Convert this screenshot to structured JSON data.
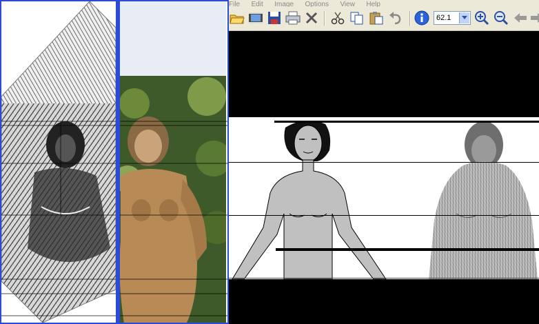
{
  "menu": [
    "File",
    "Edit",
    "Image",
    "Options",
    "View",
    "Help"
  ],
  "toolbar": {
    "icons": [
      "open-folder-icon",
      "slideshow-icon",
      "save-icon",
      "print-icon",
      "delete-icon",
      "cut-icon",
      "copy-icon",
      "paste-icon",
      "undo-icon",
      "info-icon",
      "zoom-in-icon",
      "zoom-out-icon",
      "back-arrow-icon",
      "forward-arrow-icon"
    ],
    "zoom_value": "62.1"
  },
  "colors": {
    "panel_border": "#2a4bd7",
    "toolbar_bg": "#ece9d8",
    "canvas_bg": "#000000",
    "figure_fill": "#c0c0c0"
  }
}
